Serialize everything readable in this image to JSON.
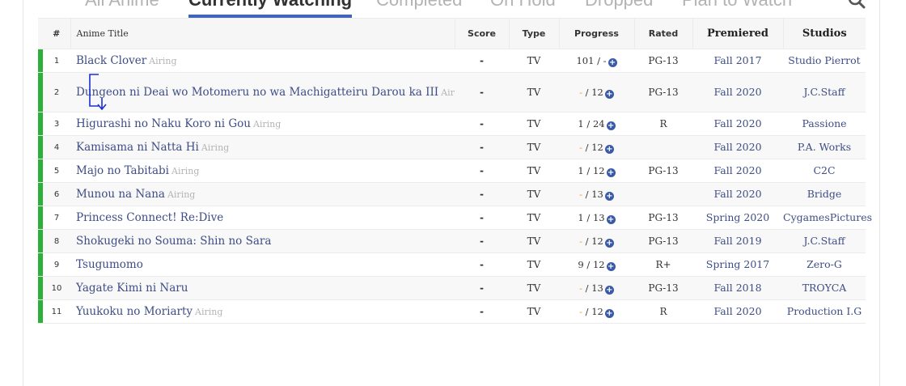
{
  "tabs": [
    {
      "label": "All Anime",
      "active": false
    },
    {
      "label": "Currently Watching",
      "active": true
    },
    {
      "label": "Completed",
      "active": false
    },
    {
      "label": "On Hold",
      "active": false
    },
    {
      "label": "Dropped",
      "active": false
    },
    {
      "label": "Plan to Watch",
      "active": false
    }
  ],
  "search": {
    "icon": "search-icon"
  },
  "table": {
    "headers": {
      "num": "#",
      "title": "Anime Title",
      "score": "Score",
      "type": "Type",
      "progress": "Progress",
      "rated": "Rated",
      "premiered": "Premiered",
      "studios": "Studios"
    },
    "status_color": "#2db039",
    "add_icon": "plus-circle-icon",
    "rows": [
      {
        "num": "1",
        "title": "Black Clover",
        "airing": "Airing",
        "score": "-",
        "type": "TV",
        "progress_current": "101",
        "progress_total": "-",
        "rated": "PG-13",
        "premiered": "Fall 2017",
        "studios": "Studio Pierrot"
      },
      {
        "num": "2",
        "title": "Dungeon ni Deai wo Motomeru no wa Machigatteiru Darou ka III",
        "airing": "Airing",
        "score": "-",
        "type": "TV",
        "progress_current": "-",
        "progress_total": "12",
        "rated": "PG-13",
        "premiered": "Fall 2020",
        "studios": "J.C.Staff"
      },
      {
        "num": "3",
        "title": "Higurashi no Naku Koro ni Gou",
        "airing": "Airing",
        "score": "-",
        "type": "TV",
        "progress_current": "1",
        "progress_total": "24",
        "rated": "R",
        "premiered": "Fall 2020",
        "studios": "Passione"
      },
      {
        "num": "4",
        "title": "Kamisama ni Natta Hi",
        "airing": "Airing",
        "score": "-",
        "type": "TV",
        "progress_current": "-",
        "progress_total": "12",
        "rated": "",
        "premiered": "Fall 2020",
        "studios": "P.A. Works"
      },
      {
        "num": "5",
        "title": "Majo no Tabitabi",
        "airing": "Airing",
        "score": "-",
        "type": "TV",
        "progress_current": "1",
        "progress_total": "12",
        "rated": "PG-13",
        "premiered": "Fall 2020",
        "studios": "C2C"
      },
      {
        "num": "6",
        "title": "Munou na Nana",
        "airing": "Airing",
        "score": "-",
        "type": "TV",
        "progress_current": "-",
        "progress_total": "13",
        "rated": "",
        "premiered": "Fall 2020",
        "studios": "Bridge"
      },
      {
        "num": "7",
        "title": "Princess Connect! Re:Dive",
        "airing": "",
        "score": "-",
        "type": "TV",
        "progress_current": "1",
        "progress_total": "13",
        "rated": "PG-13",
        "premiered": "Spring 2020",
        "studios": "CygamesPictures"
      },
      {
        "num": "8",
        "title": "Shokugeki no Souma: Shin no Sara",
        "airing": "",
        "score": "-",
        "type": "TV",
        "progress_current": "-",
        "progress_total": "12",
        "rated": "PG-13",
        "premiered": "Fall 2019",
        "studios": "J.C.Staff"
      },
      {
        "num": "9",
        "title": "Tsugumomo",
        "airing": "",
        "score": "-",
        "type": "TV",
        "progress_current": "9",
        "progress_total": "12",
        "rated": "R+",
        "premiered": "Spring 2017",
        "studios": "Zero-G"
      },
      {
        "num": "10",
        "title": "Yagate Kimi ni Naru",
        "airing": "",
        "score": "-",
        "type": "TV",
        "progress_current": "-",
        "progress_total": "13",
        "rated": "PG-13",
        "premiered": "Fall 2018",
        "studios": "TROYCA"
      },
      {
        "num": "11",
        "title": "Yuukoku no Moriarty",
        "airing": "Airing",
        "score": "-",
        "type": "TV",
        "progress_current": "-",
        "progress_total": "12",
        "rated": "R",
        "premiered": "Fall 2020",
        "studios": "Production I.G"
      }
    ]
  }
}
